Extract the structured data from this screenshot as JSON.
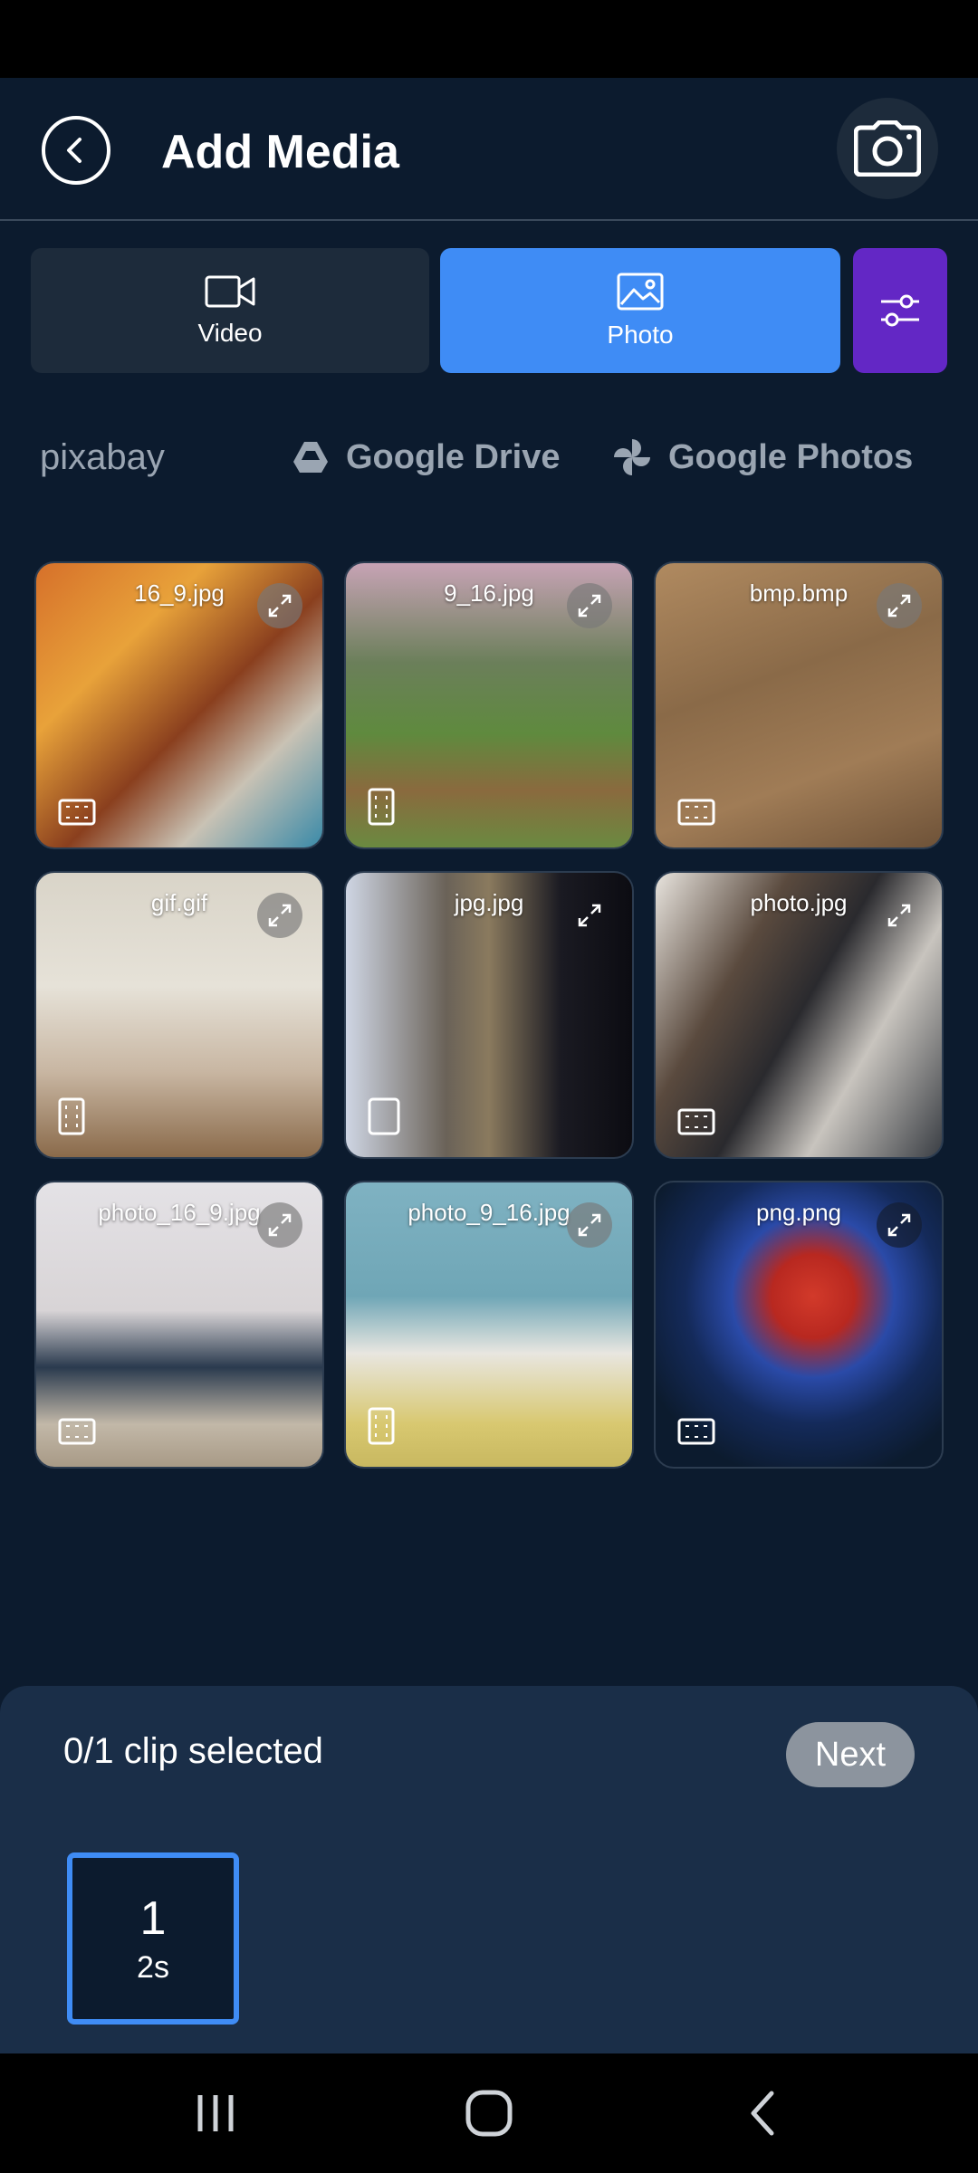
{
  "header": {
    "title": "Add Media",
    "back_icon": "chevron-left-circle-icon",
    "camera_icon": "camera-icon"
  },
  "media_types": {
    "video_label": "Video",
    "photo_label": "Photo",
    "selected": "Photo",
    "filter_icon": "sliders-icon",
    "colors": {
      "video_bg": "#1d2b3b",
      "photo_bg": "#3f8cf5",
      "filter_bg": "#6327c5"
    }
  },
  "sources": [
    {
      "label": "pixabay",
      "icon": ""
    },
    {
      "label": "Google Drive",
      "icon": "google-drive-icon"
    },
    {
      "label": "Google Photos",
      "icon": "google-photos-icon"
    }
  ],
  "media": [
    {
      "name": "16_9.jpg",
      "orientation": "landscape"
    },
    {
      "name": "9_16.jpg",
      "orientation": "portrait"
    },
    {
      "name": "bmp.bmp",
      "orientation": "landscape"
    },
    {
      "name": "gif.gif",
      "orientation": "portrait"
    },
    {
      "name": "jpg.jpg",
      "orientation": "square"
    },
    {
      "name": "photo.jpg",
      "orientation": "landscape"
    },
    {
      "name": "photo_16_9.jpg",
      "orientation": "landscape"
    },
    {
      "name": "photo_9_16.jpg",
      "orientation": "portrait"
    },
    {
      "name": "png.png",
      "orientation": "landscape"
    }
  ],
  "selection": {
    "count_label": "0/1 clip selected",
    "next_label": "Next",
    "slot_number": "1",
    "slot_duration": "2s"
  },
  "nav": {
    "recents_icon": "recents-icon",
    "home_icon": "home-icon",
    "back_icon": "back-icon"
  }
}
